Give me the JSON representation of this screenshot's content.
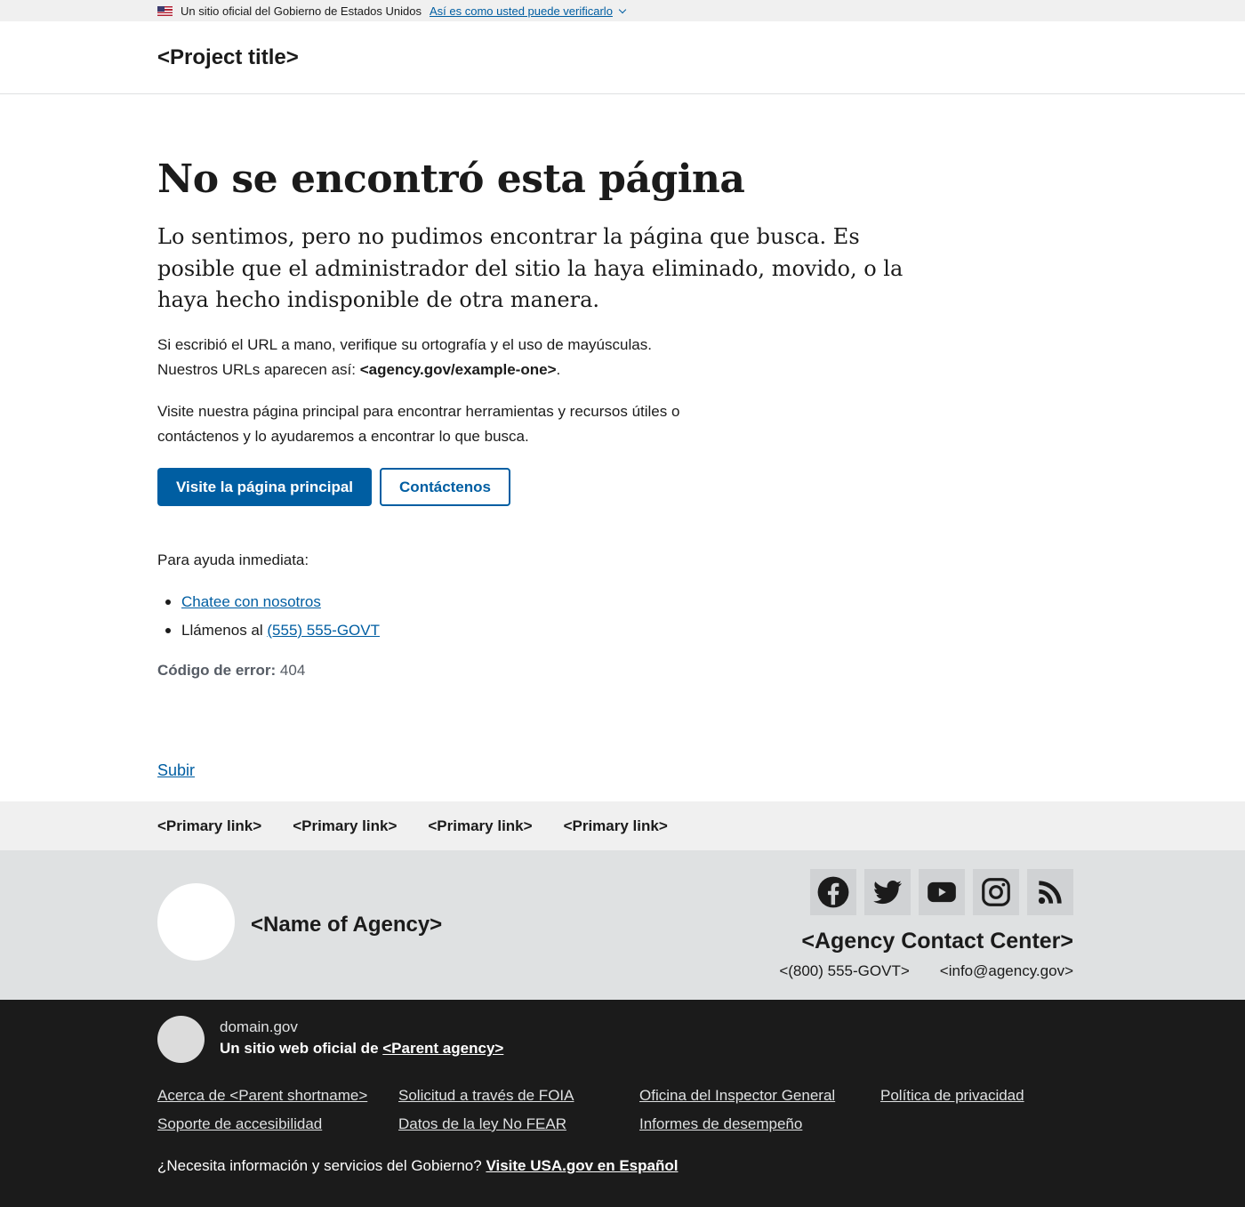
{
  "banner": {
    "official_text": "Un sitio oficial del Gobierno de Estados Unidos",
    "verify_link": "Así es como usted puede verificarlo"
  },
  "header": {
    "project_title": "<Project title>"
  },
  "main": {
    "heading": "No se encontró esta página",
    "lead": "Lo sentimos, pero no pudimos encontrar la página que busca. Es posible que el administrador del sitio la haya eliminado, movido, o la haya hecho indisponible de otra manera.",
    "url_hint_line1": "Si escribió el URL a mano, verifique su ortografía y el uso de mayúsculas.",
    "url_hint_line2_prefix": "Nuestros URLs aparecen así: ",
    "url_example": "<agency.gov/example-one>",
    "url_hint_line2_suffix": ".",
    "visit_text": "Visite nuestra página principal para encontrar herramientas y recursos útiles o contáctenos y lo ayudaremos a encontrar lo que busca.",
    "primary_button": "Visite la página principal",
    "secondary_button": "Contáctenos",
    "help_title": "Para ayuda inmediata:",
    "help_chat": "Chatee con nosotros",
    "help_call_prefix": "Llámenos al ",
    "help_phone": "(555) 555-GOVT",
    "error_label": "Código de error:",
    "error_code": "404",
    "return_to_top": "Subir"
  },
  "footer_primary": {
    "links": [
      "<Primary link>",
      "<Primary link>",
      "<Primary link>",
      "<Primary link>"
    ]
  },
  "footer_secondary": {
    "agency_name": "<Name of Agency>",
    "social_icons": [
      "facebook-icon",
      "twitter-icon",
      "youtube-icon",
      "instagram-icon",
      "rss-icon"
    ],
    "contact_center": "<Agency Contact Center>",
    "phone": "<(800) 555-GOVT>",
    "email": "<info@agency.gov>"
  },
  "identifier": {
    "domain": "domain.gov",
    "official_prefix": "Un sitio web oficial de ",
    "parent_agency": "<Parent agency>",
    "links": [
      "Acerca de <Parent shortname>",
      "Solicitud a través de FOIA",
      "Oficina del Inspector General",
      "Política de privacidad",
      "Soporte de accesibilidad",
      "Datos de la ley No FEAR",
      "Informes de desempeño"
    ],
    "usa_prefix": "¿Necesita información y servicios del Gobierno? ",
    "usa_link": "Visite USA.gov en Español"
  },
  "colors": {
    "primary": "#005ea2",
    "banner_bg": "#f0f0f0",
    "footer_secondary_bg": "#dfe1e2",
    "identifier_bg": "#1b1b1b"
  }
}
